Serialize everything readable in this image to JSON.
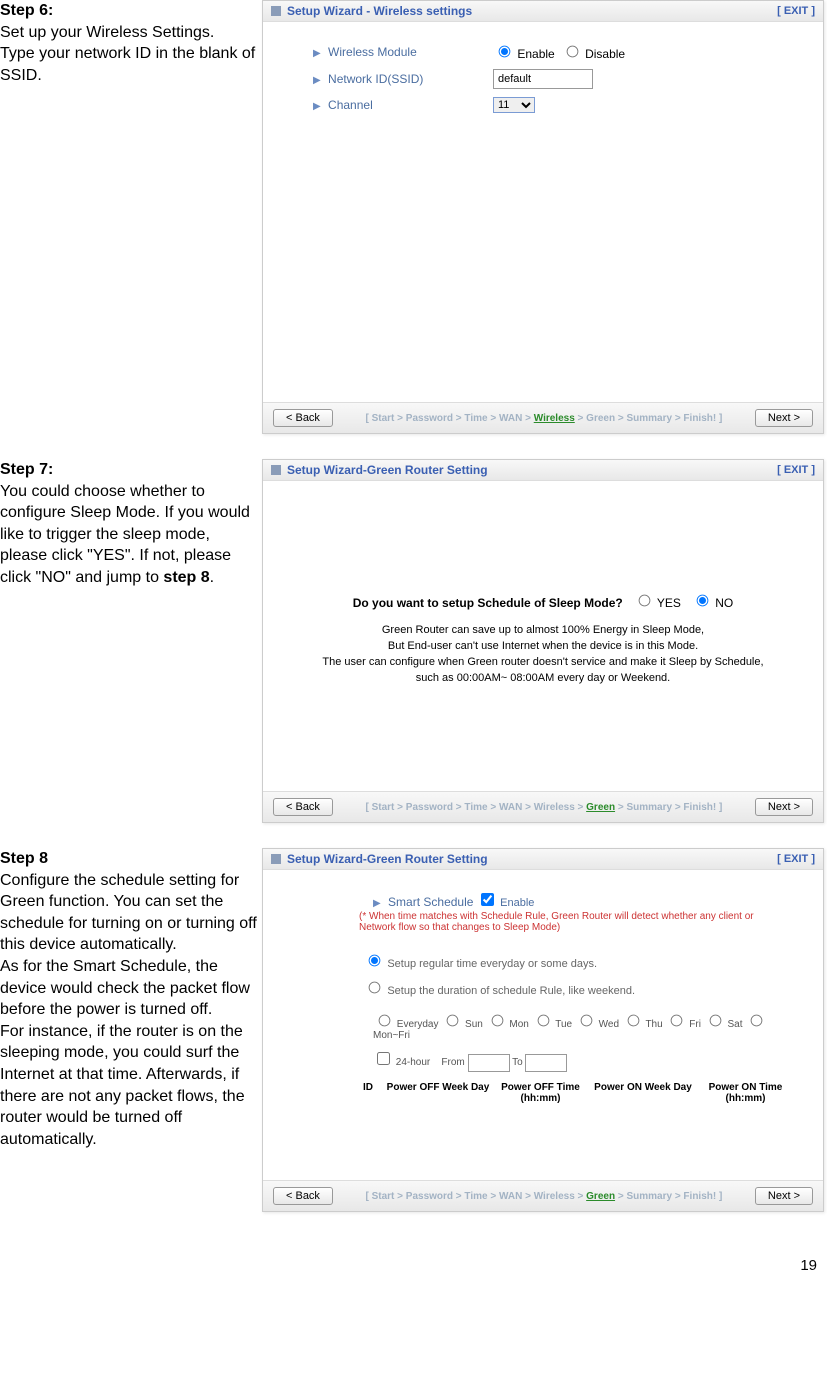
{
  "page_number": "19",
  "step6": {
    "heading": "Step 6:",
    "text1": "Set up your Wireless Settings.",
    "text2": "Type your network ID in the blank of SSID.",
    "panel_title": "Setup Wizard - Wireless settings",
    "exit": "[ EXIT ]",
    "field1": "Wireless Module",
    "field2": "Network ID(SSID)",
    "field3": "Channel",
    "enable": "Enable",
    "disable": "Disable",
    "ssid_value": "default",
    "channel_value": "11",
    "back": "< Back",
    "next": "Next >",
    "crumb": "[ Start > Password > Time > WAN > ",
    "crumb_active": "Wireless",
    "crumb_after": " > Green > Summary > Finish! ]"
  },
  "step7": {
    "heading": "Step 7:",
    "text": "You could choose whether to configure Sleep Mode. If you would like to trigger the sleep mode, please click \"YES\". If not, please click \"NO\" and jump to ",
    "text_bold": "step 8",
    "text_end": ".",
    "panel_title": "Setup Wizard-Green Router Setting",
    "exit": "[ EXIT ]",
    "question": "Do you want to setup Schedule of Sleep Mode?",
    "yes": "YES",
    "no": "NO",
    "desc1": "Green Router can save up to almost 100% Energy in Sleep Mode,",
    "desc2": "But End-user can't use Internet when the device is in this Mode.",
    "desc3": "The user can configure when Green router doesn't service and make it Sleep by Schedule,",
    "desc4": "such as 00:00AM~ 08:00AM every day or Weekend.",
    "back": "< Back",
    "next": "Next >",
    "crumb": "[ Start > Password > Time > WAN > Wireless > ",
    "crumb_active": "Green",
    "crumb_after": " > Summary > Finish! ]"
  },
  "step8": {
    "heading": "Step 8",
    "text1": "Configure the schedule setting for Green function. You can set the schedule for turning on or turning off this device automatically.",
    "text2": "As for the Smart Schedule, the device would check the packet flow before the power is turned off.",
    "text3": "For instance, if the router is on the sleeping mode, you could surf the Internet at that time. Afterwards, if there are not any packet flows, the router would be turned off automatically.",
    "panel_title": "Setup Wizard-Green Router Setting",
    "exit": "[ EXIT ]",
    "smart_schedule": "Smart Schedule",
    "enable_chk": "Enable",
    "note": "(* When time matches with Schedule Rule, Green Router will detect whether any client or Network flow so that changes to Sleep Mode)",
    "opt_regular": "Setup regular time everyday or some days.",
    "opt_duration": "Setup the duration of schedule Rule, like weekend.",
    "days": [
      "Everyday",
      "Sun",
      "Mon",
      "Tue",
      "Wed",
      "Thu",
      "Fri",
      "Sat",
      "Mon~Fri"
    ],
    "hr24": "24-hour",
    "from": "From",
    "to": "To",
    "th_id": "ID",
    "th_offday": "Power OFF Week Day",
    "th_offtime": "Power OFF Time (hh:mm)",
    "th_onday": "Power ON Week Day",
    "th_ontime": "Power ON Time (hh:mm)",
    "back": "< Back",
    "next": "Next >",
    "crumb": "[ Start > Password > Time > WAN > Wireless > ",
    "crumb_active": "Green",
    "crumb_after": " > Summary > Finish! ]"
  }
}
